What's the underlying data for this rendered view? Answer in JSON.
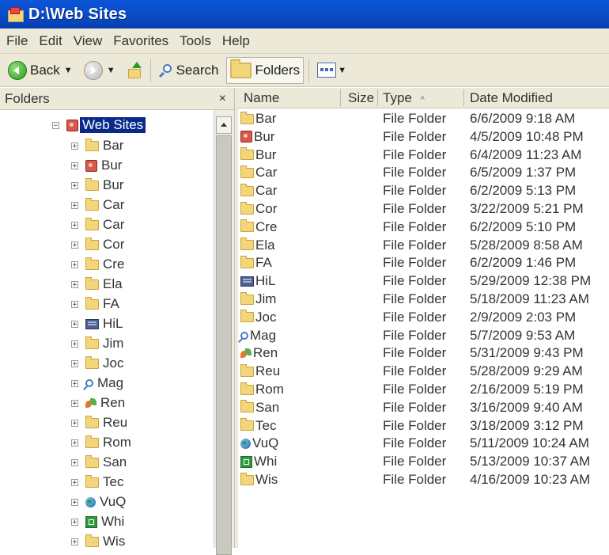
{
  "window": {
    "title": "D:\\Web Sites"
  },
  "menu": [
    "File",
    "Edit",
    "View",
    "Favorites",
    "Tools",
    "Help"
  ],
  "toolbar": {
    "back": "Back",
    "search": "Search",
    "folders": "Folders"
  },
  "folders_pane": {
    "title": "Folders",
    "close": "×",
    "root": {
      "label": "Web Sites",
      "icon": "website-icon",
      "expander": "−"
    },
    "children": [
      {
        "label": "Bar",
        "icon": "folder-icon"
      },
      {
        "label": "Bur",
        "icon": "website-icon"
      },
      {
        "label": "Bur",
        "icon": "folder-icon"
      },
      {
        "label": "Car",
        "icon": "folder-icon"
      },
      {
        "label": "Car",
        "icon": "folder-icon"
      },
      {
        "label": "Cor",
        "icon": "folder-icon"
      },
      {
        "label": "Cre",
        "icon": "folder-icon"
      },
      {
        "label": "Ela",
        "icon": "folder-icon"
      },
      {
        "label": "FA",
        "icon": "folder-icon"
      },
      {
        "label": "HiL",
        "icon": "monitor-icon"
      },
      {
        "label": "Jim",
        "icon": "folder-icon"
      },
      {
        "label": "Joc",
        "icon": "folder-icon"
      },
      {
        "label": "Mag",
        "icon": "search-icon"
      },
      {
        "label": "Ren",
        "icon": "leaf-icon"
      },
      {
        "label": "Reu",
        "icon": "folder-icon"
      },
      {
        "label": "Rom",
        "icon": "folder-icon"
      },
      {
        "label": "San",
        "icon": "folder-icon"
      },
      {
        "label": "Tec",
        "icon": "folder-icon"
      },
      {
        "label": "VuQ",
        "icon": "globe-icon"
      },
      {
        "label": "Whi",
        "icon": "green-box-icon"
      },
      {
        "label": "Wis",
        "icon": "folder-icon"
      }
    ]
  },
  "list": {
    "columns": {
      "name": "Name",
      "size": "Size",
      "type": "Type",
      "sort_indicator": "^",
      "date": "Date Modified"
    },
    "rows": [
      {
        "name": "Bar",
        "icon": "folder-icon",
        "type": "File Folder",
        "date": "6/6/2009 9:18 AM"
      },
      {
        "name": "Bur",
        "icon": "website-icon",
        "type": "File Folder",
        "date": "4/5/2009 10:48 PM"
      },
      {
        "name": "Bur",
        "icon": "folder-icon",
        "type": "File Folder",
        "date": "6/4/2009 11:23 AM"
      },
      {
        "name": "Car",
        "icon": "folder-icon",
        "type": "File Folder",
        "date": "6/5/2009 1:37 PM"
      },
      {
        "name": "Car",
        "icon": "folder-icon",
        "type": "File Folder",
        "date": "6/2/2009 5:13 PM"
      },
      {
        "name": "Cor",
        "icon": "folder-icon",
        "type": "File Folder",
        "date": "3/22/2009 5:21 PM"
      },
      {
        "name": "Cre",
        "icon": "folder-icon",
        "type": "File Folder",
        "date": "6/2/2009 5:10 PM"
      },
      {
        "name": "Ela",
        "icon": "folder-icon",
        "type": "File Folder",
        "date": "5/28/2009 8:58 AM"
      },
      {
        "name": "FA",
        "icon": "folder-icon",
        "type": "File Folder",
        "date": "6/2/2009 1:46 PM"
      },
      {
        "name": "HiL",
        "icon": "monitor-icon",
        "type": "File Folder",
        "date": "5/29/2009 12:38 PM"
      },
      {
        "name": "Jim",
        "icon": "folder-icon",
        "type": "File Folder",
        "date": "5/18/2009 11:23 AM"
      },
      {
        "name": "Joc",
        "icon": "folder-icon",
        "type": "File Folder",
        "date": "2/9/2009 2:03 PM"
      },
      {
        "name": "Mag",
        "icon": "search-icon",
        "type": "File Folder",
        "date": "5/7/2009 9:53 AM"
      },
      {
        "name": "Ren",
        "icon": "leaf-icon",
        "type": "File Folder",
        "date": "5/31/2009 9:43 PM"
      },
      {
        "name": "Reu",
        "icon": "folder-icon",
        "type": "File Folder",
        "date": "5/28/2009 9:29 AM"
      },
      {
        "name": "Rom",
        "icon": "folder-icon",
        "type": "File Folder",
        "date": "2/16/2009 5:19 PM"
      },
      {
        "name": "San",
        "icon": "folder-icon",
        "type": "File Folder",
        "date": "3/16/2009 9:40 AM"
      },
      {
        "name": "Tec",
        "icon": "folder-icon",
        "type": "File Folder",
        "date": "3/18/2009 3:12 PM"
      },
      {
        "name": "VuQ",
        "icon": "globe-icon",
        "type": "File Folder",
        "date": "5/11/2009 10:24 AM"
      },
      {
        "name": "Whi",
        "icon": "green-box-icon",
        "type": "File Folder",
        "date": "5/13/2009 10:37 AM"
      },
      {
        "name": "Wis",
        "icon": "folder-icon",
        "type": "File Folder",
        "date": "4/16/2009 10:23 AM"
      }
    ]
  }
}
